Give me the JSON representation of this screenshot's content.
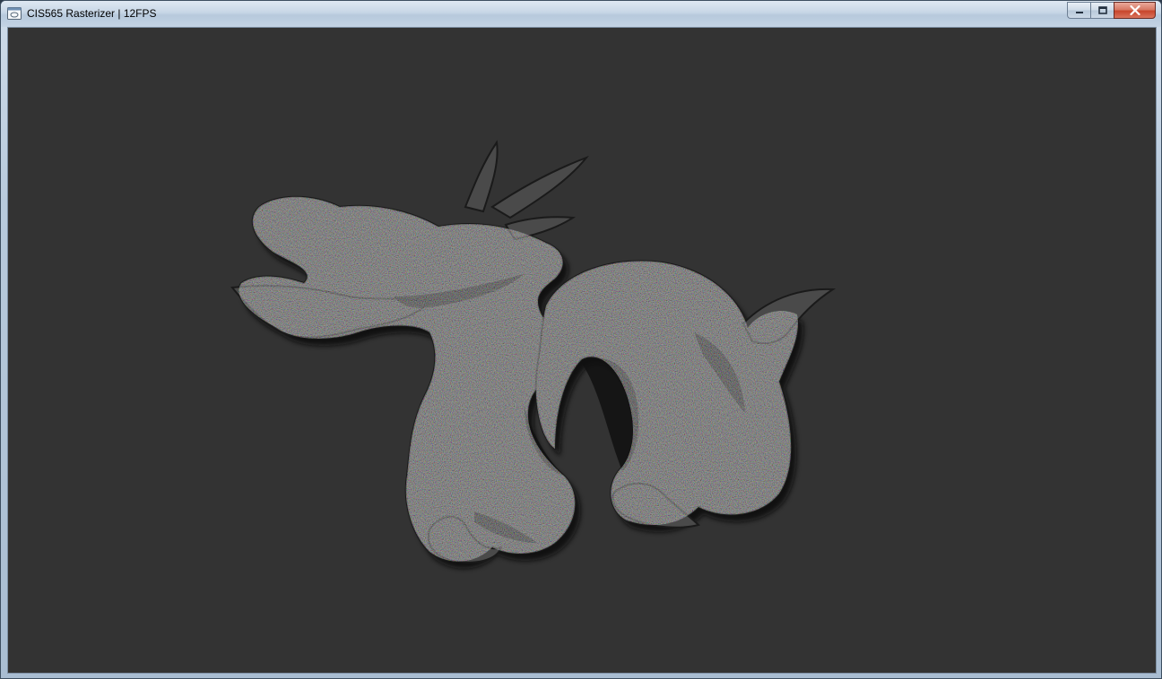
{
  "window": {
    "title": "CIS565 Rasterizer | 12FPS",
    "app_icon": "app-window-icon",
    "controls": {
      "minimize_icon": "minimize-icon",
      "maximize_icon": "maximize-icon",
      "close_icon": "close-icon"
    },
    "colors": {
      "viewport_background": "#333333",
      "model_base": "#4a4a4a"
    }
  },
  "viewport": {
    "model": "dragon"
  }
}
